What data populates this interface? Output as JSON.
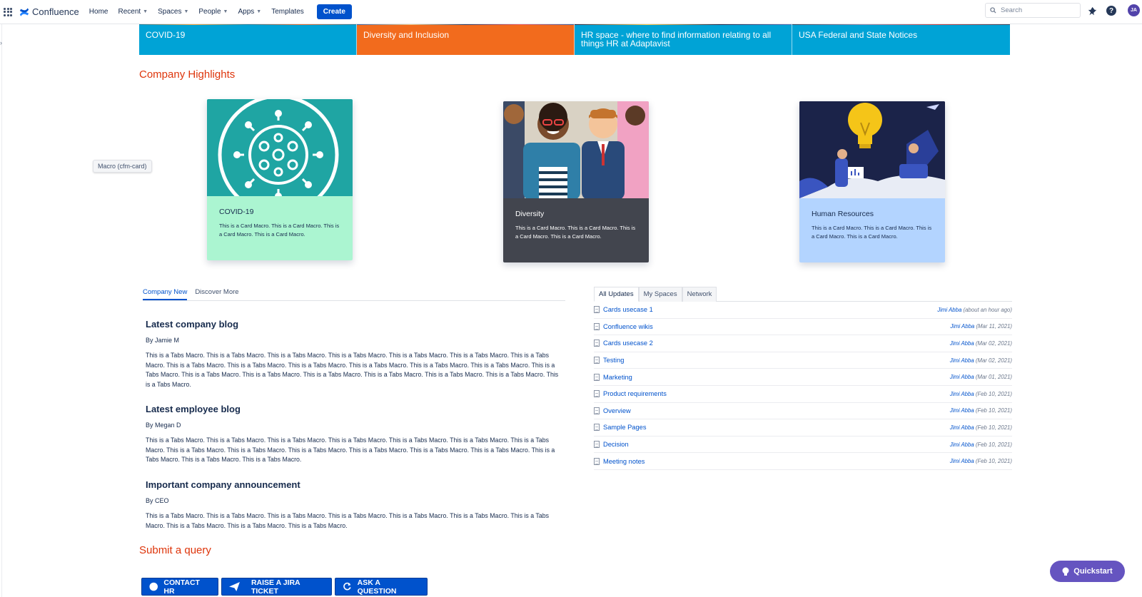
{
  "nav": {
    "logo_text": "Confluence",
    "items": [
      {
        "label": "Home",
        "dropdown": false
      },
      {
        "label": "Recent",
        "dropdown": true
      },
      {
        "label": "Spaces",
        "dropdown": true
      },
      {
        "label": "People",
        "dropdown": true
      },
      {
        "label": "Apps",
        "dropdown": true
      },
      {
        "label": "Templates",
        "dropdown": false
      }
    ],
    "create_label": "Create",
    "search_placeholder": "Search",
    "help_label": "?",
    "avatar_initials": "JA"
  },
  "banner": {
    "tiles": [
      {
        "label": "COVID-19",
        "color": "#00a3d6"
      },
      {
        "label": "Diversity and Inclusion",
        "color": "#f26b1d"
      },
      {
        "label": "HR space - where to find information relating to all things HR at Adaptavist",
        "color": "#00a3d6"
      },
      {
        "label": "USA Federal and State Notices",
        "color": "#00a3d6"
      }
    ]
  },
  "highlights": {
    "title": "Company Highlights",
    "tooltip": "Macro (cfm-card)",
    "cards": [
      {
        "title": "COVID-19",
        "text": "This is a Card Macro. This is a Card Macro. This is a Card Macro. This is a Card Macro.",
        "body_color": "#abf5d1",
        "text_color": "#172b4d"
      },
      {
        "title": "Diversity",
        "text": "This is a Card Macro. This is a Card Macro. This is a Card Macro. This is a Card Macro.",
        "body_color": "#42454e",
        "text_color": "#ffffff"
      },
      {
        "title": "Human Resources",
        "text": "This is a Card Macro. This is a Card Macro. This is a Card Macro. This is a Card Macro.",
        "body_color": "#b3d4ff",
        "text_color": "#172b4d"
      }
    ]
  },
  "left_tabs": {
    "tabs": [
      "Company New",
      "Discover More"
    ],
    "posts": [
      {
        "title": "Latest company blog",
        "by": "By Jamie M",
        "text": "This is a Tabs Macro. This is a Tabs Macro. This is a Tabs Macro. This is a Tabs Macro. This is a Tabs Macro. This is a Tabs Macro. This is a Tabs Macro. This is a Tabs Macro. This is a Tabs Macro. This is a Tabs Macro. This is a Tabs Macro. This is a Tabs Macro. This is a Tabs Macro. This is a Tabs Macro. This is a Tabs Macro. This is a Tabs Macro. This is a Tabs Macro. This is a Tabs Macro. This is a Tabs Macro. This is a Tabs Macro. This is a Tabs Macro."
      },
      {
        "title": "Latest employee blog",
        "by": "By Megan D",
        "text": "This is a Tabs Macro. This is a Tabs Macro. This is a Tabs Macro. This is a Tabs Macro. This is a Tabs Macro. This is a Tabs Macro. This is a Tabs Macro. This is a Tabs Macro. This is a Tabs Macro. This is a Tabs Macro. This is a Tabs Macro. This is a Tabs Macro. This is a Tabs Macro. This is a Tabs Macro. This is a Tabs Macro. This is a Tabs Macro."
      },
      {
        "title": "Important company announcement",
        "by": "By CEO",
        "text": "This is a Tabs Macro. This is a Tabs Macro. This is a Tabs Macro. This is a Tabs Macro. This is a Tabs Macro. This is a Tabs Macro. This is a Tabs Macro. This is a Tabs Macro. This is a Tabs Macro. This is a Tabs Macro."
      }
    ]
  },
  "updates": {
    "tabs": [
      "All Updates",
      "My Spaces",
      "Network"
    ],
    "rows": [
      {
        "title": "Cards usecase 1",
        "author": "Jimi Abba",
        "when": "(about an hour ago)"
      },
      {
        "title": "Confluence wikis",
        "author": "Jimi Abba",
        "when": "(Mar 11, 2021)"
      },
      {
        "title": "Cards usecase 2",
        "author": "Jimi Abba",
        "when": "(Mar 02, 2021)"
      },
      {
        "title": "Testing",
        "author": "Jimi Abba",
        "when": "(Mar 02, 2021)"
      },
      {
        "title": "Marketing",
        "author": "Jimi Abba",
        "when": "(Mar 01, 2021)"
      },
      {
        "title": "Product requirements",
        "author": "Jimi Abba",
        "when": "(Feb 10, 2021)"
      },
      {
        "title": "Overview",
        "author": "Jimi Abba",
        "when": "(Feb 10, 2021)"
      },
      {
        "title": "Sample Pages",
        "author": "Jimi Abba",
        "when": "(Feb 10, 2021)"
      },
      {
        "title": "Decision",
        "author": "Jimi Abba",
        "when": "(Feb 10, 2021)"
      },
      {
        "title": "Meeting notes",
        "author": "Jimi Abba",
        "when": "(Feb 10, 2021)"
      }
    ]
  },
  "query": {
    "title": "Submit a query",
    "buttons": [
      "CONTACT HR",
      "RAISE A JIRA TICKET",
      "ASK A QUESTION"
    ]
  },
  "quickstart_label": "Quickstart"
}
